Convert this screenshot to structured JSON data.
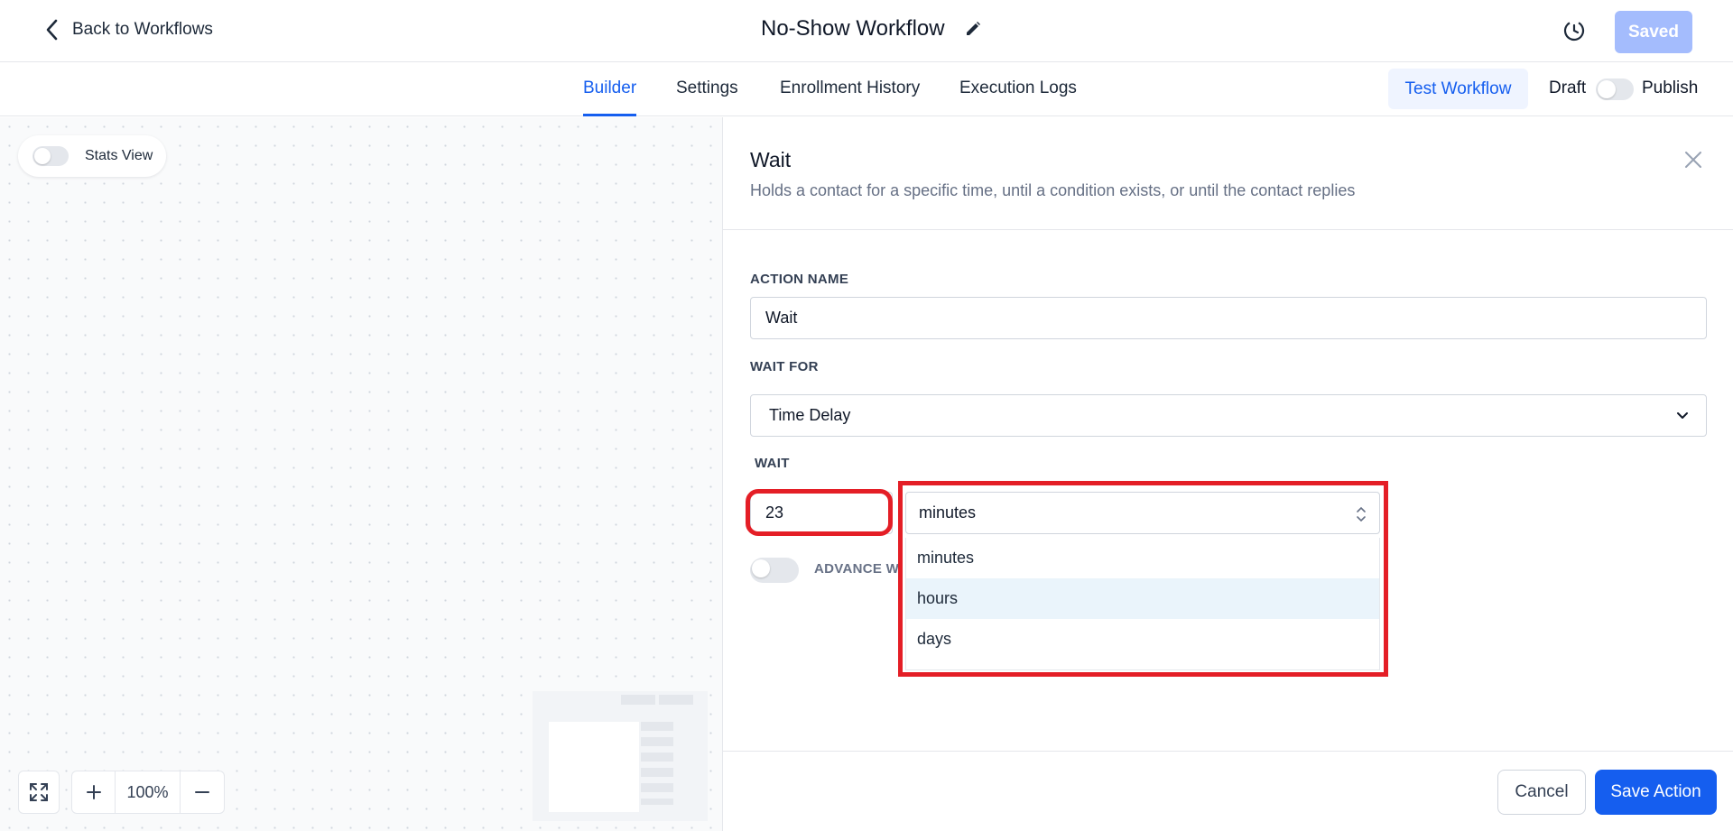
{
  "header": {
    "back_label": "Back to Workflows",
    "workflow_title": "No-Show Workflow",
    "saved_label": "Saved",
    "history_icon": "history-icon",
    "edit_icon": "pencil-icon"
  },
  "tabs": {
    "items": [
      {
        "label": "Builder",
        "active": true
      },
      {
        "label": "Settings",
        "active": false
      },
      {
        "label": "Enrollment History",
        "active": false
      },
      {
        "label": "Execution Logs",
        "active": false
      }
    ],
    "test_label": "Test Workflow",
    "draft_label": "Draft",
    "publish_label": "Publish",
    "publish_toggle_on": false
  },
  "canvas": {
    "stats_label": "Stats View",
    "stats_toggle_on": false,
    "zoom_level": "100%"
  },
  "panel": {
    "title": "Wait",
    "description": "Holds a contact for a specific time, until a condition exists, or until the contact replies",
    "action_name_label": "ACTION NAME",
    "action_name_value": "Wait",
    "wait_for_label": "WAIT FOR",
    "wait_for_value": "Time Delay",
    "wait_label": "WAIT",
    "wait_amount": "23",
    "wait_unit": "minutes",
    "unit_options": [
      "minutes",
      "hours",
      "days"
    ],
    "highlighted_option": "hours",
    "advance_label": "ADVANCE W",
    "cancel_label": "Cancel",
    "save_label": "Save Action"
  },
  "colors": {
    "accent": "#155eef",
    "saved_disabled": "#a4bcfd",
    "annotation_red": "#e41e26",
    "option_highlight": "#eaf4fb"
  }
}
